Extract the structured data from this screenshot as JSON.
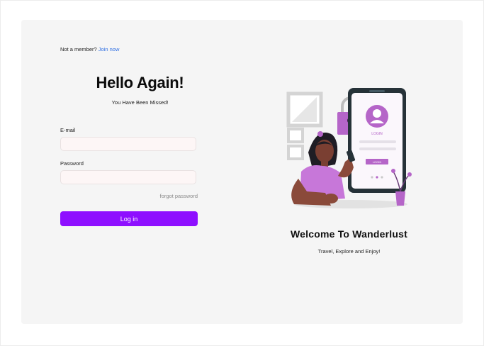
{
  "login": {
    "not_member_text": "Not a member?",
    "join_link": "Join now",
    "heading": "Hello Again!",
    "subheading": "You Have Been Missed!",
    "email_label": "E-mail",
    "email_value": "",
    "password_label": "Password",
    "password_value": "",
    "forgot_link": "forgot password",
    "login_button": "Log in"
  },
  "illustration": {
    "phone_avatar_caption": "LOGIN",
    "phone_button_label": "LOGIN",
    "icons": [
      "padlock-icon",
      "user-avatar-icon",
      "plant-icon"
    ]
  },
  "promo": {
    "title": "Welcome To Wanderlust",
    "tagline": "Travel, Explore and Enjoy!"
  },
  "colors": {
    "accent": "#8e0fff",
    "link": "#2f6fe3",
    "illustration_purple": "#b565c8",
    "card_bg": "#f5f5f5"
  }
}
